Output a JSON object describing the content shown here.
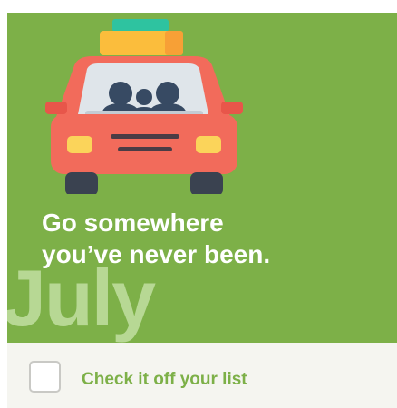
{
  "card": {
    "headline_line1": "Go somewhere",
    "headline_line2": "you’ve never been.",
    "month": "July",
    "check_label": "Check it off your list",
    "icon": "car-with-passengers-icon"
  },
  "colors": {
    "card_background": "#7db048",
    "month_text": "#b7d894",
    "footer_background": "#f5f5f0",
    "accent_text": "#7db048",
    "car_body": "#f26b5b",
    "luggage": "#fbbd3c",
    "luggage_top": "#2ec3a0"
  }
}
